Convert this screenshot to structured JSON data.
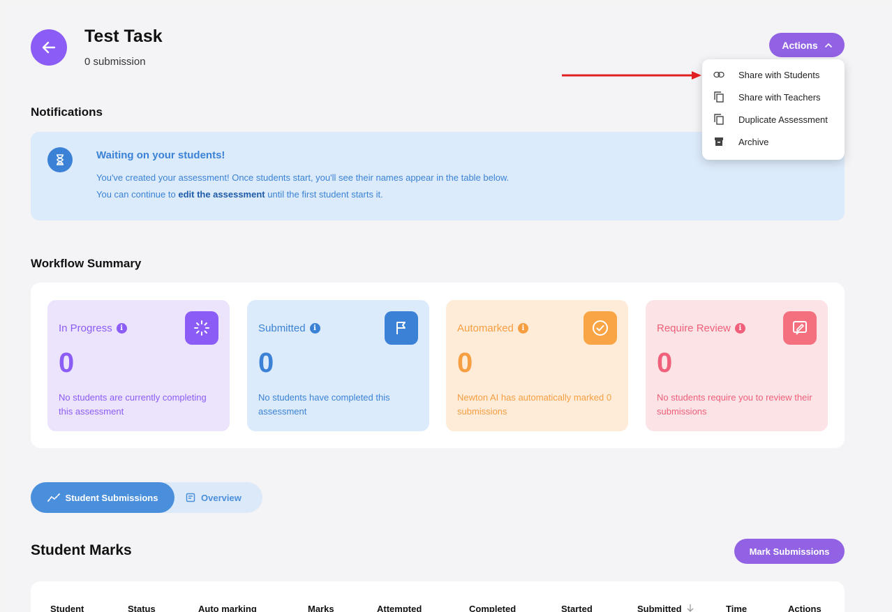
{
  "header": {
    "title": "Test Task",
    "subtitle": "0 submission",
    "actions_label": "Actions"
  },
  "actions_menu": {
    "items": [
      {
        "label": "Share with Students",
        "icon": "link-icon"
      },
      {
        "label": "Share with Teachers",
        "icon": "copy-icon"
      },
      {
        "label": "Duplicate Assessment",
        "icon": "copy-icon"
      },
      {
        "label": "Archive",
        "icon": "archive-icon"
      }
    ]
  },
  "notifications": {
    "heading": "Notifications",
    "title": "Waiting on your students!",
    "line1": "You've created your assessment! Once students start, you'll see their names appear in the table below.",
    "line2_prefix": "You can continue to ",
    "line2_link": "edit the assessment",
    "line2_suffix": " until the first student starts it."
  },
  "workflow": {
    "heading": "Workflow Summary",
    "cards": [
      {
        "label": "In Progress",
        "value": "0",
        "desc": "No students are currently completing this assessment",
        "icon": "loader-icon",
        "accent": "#8b5cf6",
        "bg": "#ece4fd"
      },
      {
        "label": "Submitted",
        "value": "0",
        "desc": "No students have completed this assessment",
        "icon": "flag-icon",
        "accent": "#3b82d6",
        "bg": "#dcebfb"
      },
      {
        "label": "Automarked",
        "value": "0",
        "desc": "Newton AI has automatically marked 0 submissions",
        "icon": "check-circle-icon",
        "accent": "#f59e42",
        "bg": "#ffecd8"
      },
      {
        "label": "Require Review",
        "value": "0",
        "desc": "No students require you to review their submissions",
        "icon": "review-icon",
        "accent": "#f0607a",
        "bg": "#fbe3e6"
      }
    ]
  },
  "tabs": {
    "student_submissions": "Student Submissions",
    "overview": "Overview"
  },
  "marks": {
    "title": "Student Marks",
    "button": "Mark Submissions",
    "columns": [
      "Student",
      "Status",
      "Auto marking",
      "Marks",
      "Attempted",
      "Completed",
      "Started",
      "Submitted",
      "Time",
      "Actions"
    ]
  },
  "colors": {
    "purple": "#9162e4",
    "blue": "#3b82d6",
    "arrow_red": "#e02020"
  }
}
